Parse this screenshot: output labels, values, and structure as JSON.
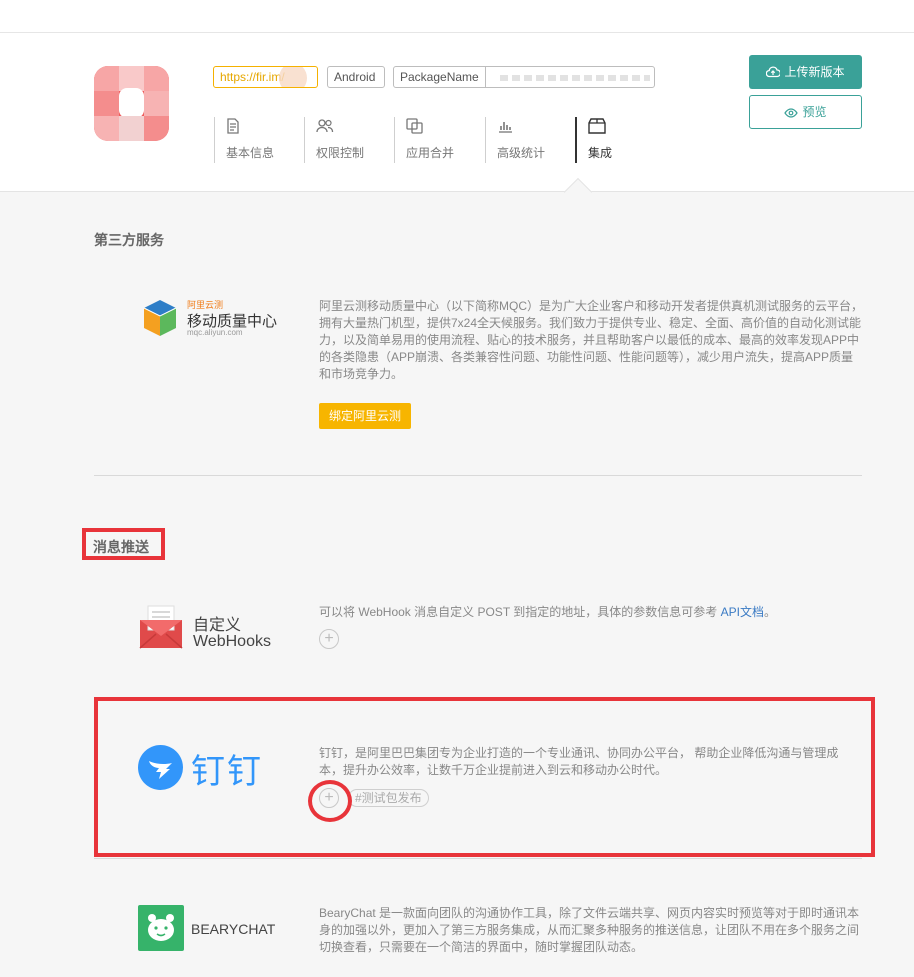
{
  "header": {
    "url_chip": "https://fir.im/",
    "platform": "Android",
    "package_label": "PackageName",
    "upload_label": "上传新版本",
    "preview_label": "预览",
    "tabs": [
      {
        "label": "基本信息",
        "icon": "doc-icon"
      },
      {
        "label": "权限控制",
        "icon": "users-icon"
      },
      {
        "label": "应用合并",
        "icon": "merge-icon"
      },
      {
        "label": "高级统计",
        "icon": "chart-icon"
      },
      {
        "label": "集成",
        "icon": "box-icon",
        "active": true
      }
    ],
    "accent_color": "#3aa198"
  },
  "third_party": {
    "title": "第三方服务",
    "mqc": {
      "logo_small": "阿里云测",
      "logo_main": "移动质量中心",
      "logo_sub": "mqc.aliyun.com",
      "description": "阿里云测移动质量中心（以下简称MQC）是为广大企业客户和移动开发者提供真机测试服务的云平台，拥有大量热门机型，提供7x24全天候服务。我们致力于提供专业、稳定、全面、高价值的自动化测试能力，以及简单易用的使用流程、贴心的技术服务，并且帮助客户以最低的成本、最高的效率发现APP中的各类隐患（APP崩溃、各类兼容性问题、功能性问题、性能问题等），减少用户流失，提高APP质量和市场竞争力。",
      "bind_label": "绑定阿里云测"
    }
  },
  "push": {
    "title": "消息推送",
    "webhook": {
      "name_line1": "自定义",
      "name_line2": "WebHooks",
      "description": "可以将 WebHook 消息自定义 POST 到指定的地址，具体的参数信息可参考 ",
      "api_link": "API文档",
      "description_end": "。"
    },
    "dingtalk": {
      "name": "钉钉",
      "description": "钉钉，是阿里巴巴集团专为企业打造的一个专业通讯、协同办公平台， 帮助企业降低沟通与管理成本，提升办公效率，让数千万企业提前进入到云和移动办公时代。",
      "tag": "#测试包发布"
    },
    "bearychat": {
      "name": "BEARYCHAT",
      "description": "BearyChat 是一款面向团队的沟通协作工具，除了文件云端共享、网页内容实时预览等对于即时通讯本身的加强以外，更加入了第三方服务集成，从而汇聚多种服务的推送信息，让团队不用在多个服务之间切换查看，只需要在一个简洁的界面中，随时掌握团队动态。"
    }
  }
}
